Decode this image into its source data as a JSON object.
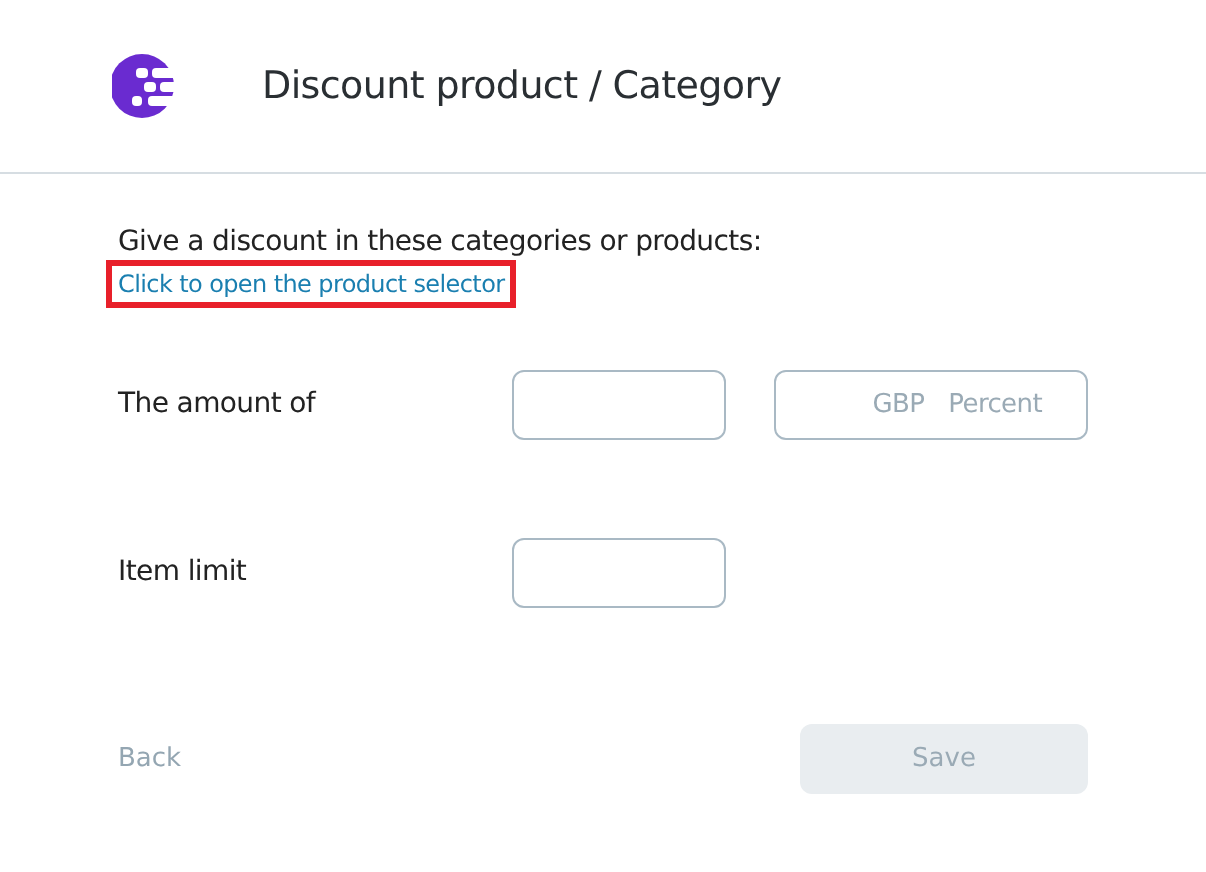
{
  "header": {
    "title": "Discount product / Category"
  },
  "selector": {
    "prompt": "Give a discount in these categories or products:",
    "link": "Click to open the product selector",
    "highlighted": true
  },
  "fields": [
    {
      "label": "The amount of",
      "kind": "amount",
      "units": [
        {
          "label": "GBP",
          "selected": false
        },
        {
          "label": "Percent",
          "selected": false
        }
      ]
    },
    {
      "label": "Item limit",
      "kind": "plain"
    }
  ],
  "footer": {
    "back": "Back",
    "save": "Save",
    "save_disabled": true
  }
}
